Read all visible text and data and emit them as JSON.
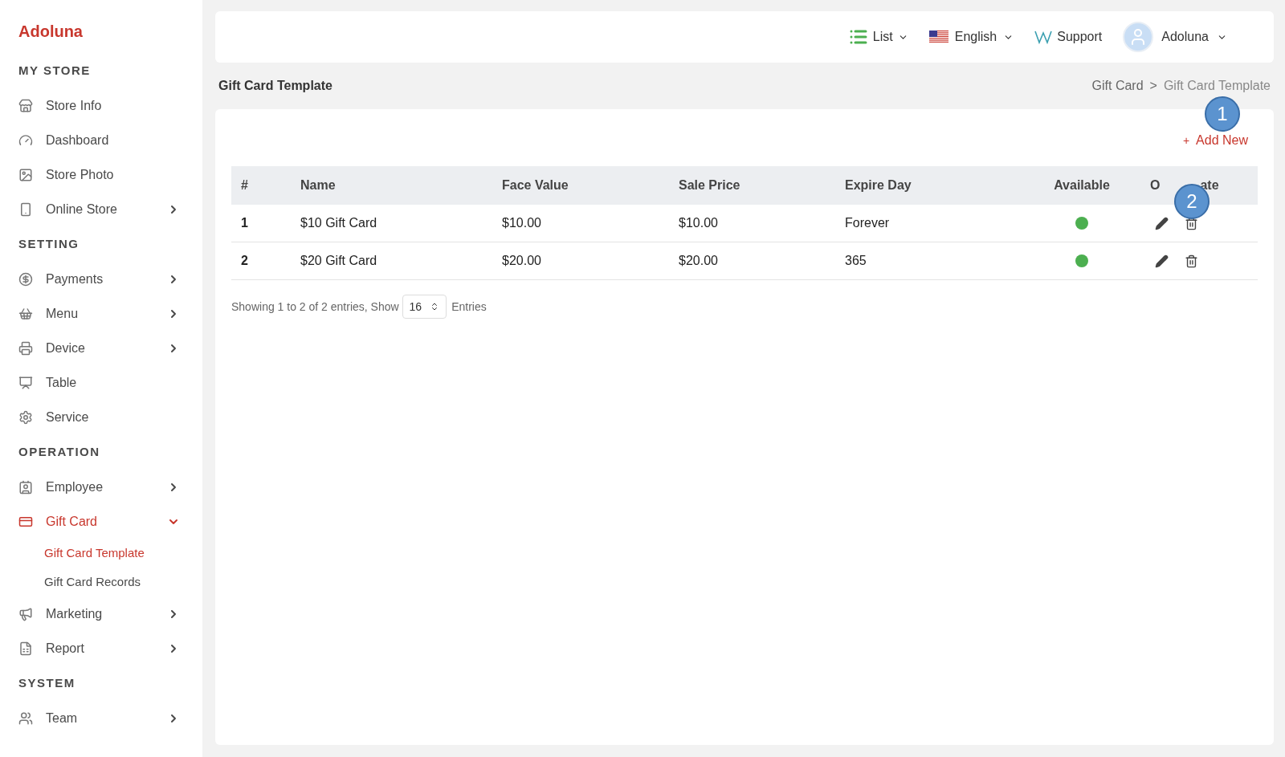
{
  "brand": "Adoluna",
  "sidebar": {
    "sections": [
      {
        "title": "MY STORE",
        "items": [
          {
            "label": "Store Info",
            "kind": "link",
            "selected": false
          },
          {
            "label": "Dashboard",
            "kind": "link",
            "selected": false
          },
          {
            "label": "Store Photo",
            "kind": "link",
            "selected": false
          },
          {
            "label": "Online Store",
            "kind": "group",
            "expanded": false,
            "selected": false
          }
        ]
      },
      {
        "title": "SETTING",
        "items": [
          {
            "label": "Payments",
            "kind": "group",
            "expanded": false,
            "selected": false
          },
          {
            "label": "Menu",
            "kind": "group",
            "expanded": false,
            "selected": false
          },
          {
            "label": "Device",
            "kind": "group",
            "expanded": false,
            "selected": false
          },
          {
            "label": "Table",
            "kind": "link",
            "selected": false
          },
          {
            "label": "Service",
            "kind": "link",
            "selected": false
          }
        ]
      },
      {
        "title": "OPERATION",
        "items": [
          {
            "label": "Employee",
            "kind": "group",
            "expanded": false,
            "selected": false
          },
          {
            "label": "Gift Card",
            "kind": "group",
            "expanded": true,
            "selected": true,
            "children": [
              {
                "label": "Gift Card Template",
                "selected": true
              },
              {
                "label": "Gift Card Records",
                "selected": false
              }
            ]
          },
          {
            "label": "Marketing",
            "kind": "group",
            "expanded": false,
            "selected": false
          },
          {
            "label": "Report",
            "kind": "group",
            "expanded": false,
            "selected": false
          }
        ]
      },
      {
        "title": "SYSTEM",
        "items": [
          {
            "label": "Team",
            "kind": "group",
            "expanded": false,
            "selected": false
          }
        ]
      }
    ]
  },
  "topbar": {
    "view": "List",
    "language": "English",
    "support": "Support",
    "user": "Adoluna"
  },
  "page_title": "Gift Card Template",
  "breadcrumb": [
    "Gift Card",
    ">",
    "Gift Card Template"
  ],
  "add_button": "Add New",
  "add_icon": "+",
  "table": {
    "columns": [
      "#",
      "Name",
      "Face Value",
      "Sale Price",
      "Expire Day",
      "Available",
      {
        "parts": [
          "O",
          "ate"
        ]
      }
    ],
    "rows": [
      {
        "index": "1",
        "name": "$10 Gift Card",
        "face_value": "$10.00",
        "sale_price": "$10.00",
        "expire_day": "Forever",
        "available": true
      },
      {
        "index": "2",
        "name": "$20 Gift Card",
        "face_value": "$20.00",
        "sale_price": "$20.00",
        "expire_day": "365",
        "available": true
      }
    ]
  },
  "pagination": {
    "summary": "Showing 1 to 2 of 2 entries, Show",
    "page_size": "16",
    "suffix": "Entries"
  },
  "annotations": [
    "1",
    "2"
  ]
}
